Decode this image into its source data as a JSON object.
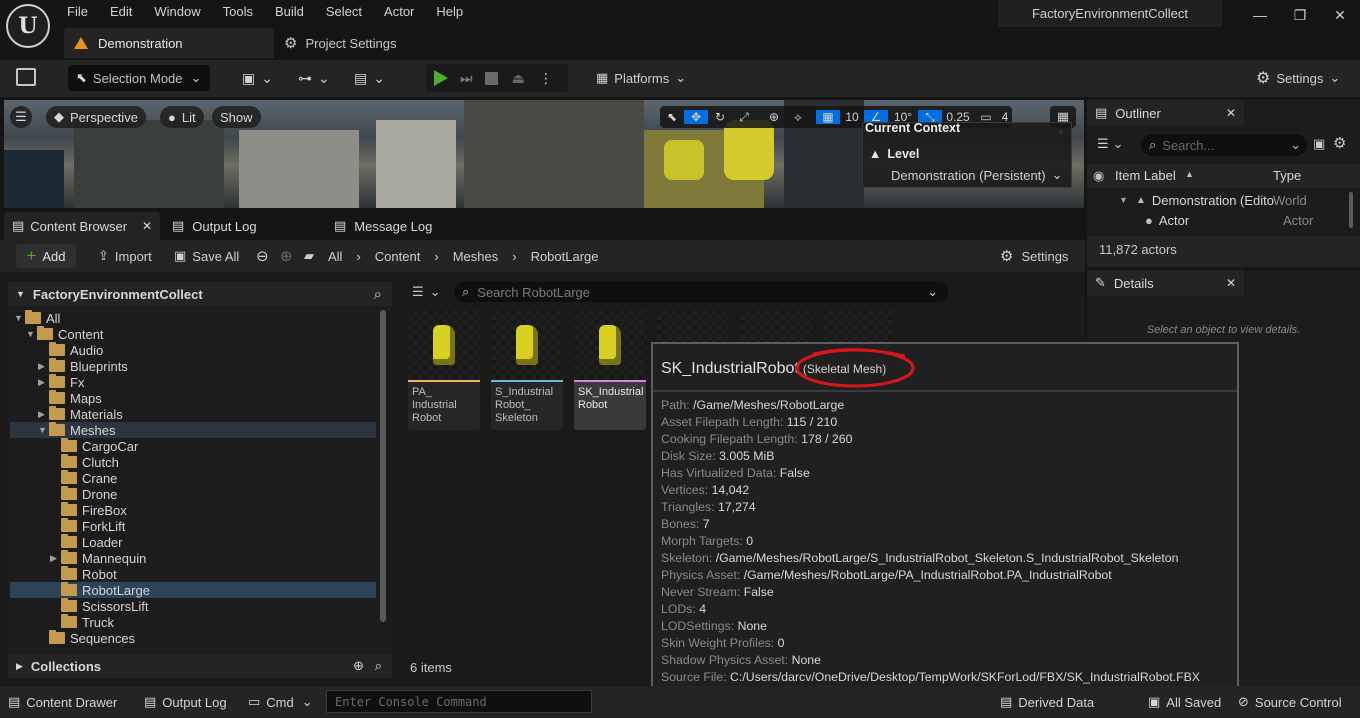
{
  "app": {
    "menu": [
      "File",
      "Edit",
      "Window",
      "Tools",
      "Build",
      "Select",
      "Actor",
      "Help"
    ],
    "document_tab": "Demonstration",
    "project_settings_tab": "Project Settings",
    "project_title": "FactoryEnvironmentCollect",
    "window_buttons": {
      "minimize": "—",
      "restore": "❐",
      "close": "✕"
    }
  },
  "toolbar": {
    "selection_mode": "Selection Mode",
    "platforms": "Platforms",
    "settings": "Settings"
  },
  "viewport": {
    "perspective": "Perspective",
    "lit": "Lit",
    "show": "Show",
    "grid_snap": "10",
    "rotation_snap": "10°",
    "scale_snap": "0.25",
    "camera_speed": "4",
    "current_context_label": "Current Context",
    "level_label": "Level",
    "level_value": "Demonstration (Persistent)"
  },
  "outliner": {
    "tab": "Outliner",
    "search_placeholder": "Search...",
    "col_label": "Item Label",
    "col_type": "Type",
    "rows": [
      {
        "label": "Demonstration (Edito",
        "type": "World"
      },
      {
        "label": "Actor",
        "type": "Actor"
      }
    ],
    "count": "11,872 actors"
  },
  "details": {
    "tab": "Details",
    "empty_text": "Select an object to view details."
  },
  "content_browser": {
    "tabs": [
      "Content Browser",
      "Output Log",
      "Message Log"
    ],
    "add": "Add",
    "import": "Import",
    "save_all": "Save All",
    "breadcrumb": [
      "All",
      "Content",
      "Meshes",
      "RobotLarge"
    ],
    "settings": "Settings",
    "tree_root": "FactoryEnvironmentCollect",
    "search_placeholder": "Search RobotLarge",
    "collections": "Collections",
    "item_count": "6 items",
    "tree": [
      {
        "label": "All",
        "depth": 0,
        "arrow": "▼"
      },
      {
        "label": "Content",
        "depth": 1,
        "arrow": "▼"
      },
      {
        "label": "Audio",
        "depth": 2,
        "arrow": ""
      },
      {
        "label": "Blueprints",
        "depth": 2,
        "arrow": "▶"
      },
      {
        "label": "Fx",
        "depth": 2,
        "arrow": "▶"
      },
      {
        "label": "Maps",
        "depth": 2,
        "arrow": ""
      },
      {
        "label": "Materials",
        "depth": 2,
        "arrow": "▶"
      },
      {
        "label": "Meshes",
        "depth": 2,
        "arrow": "▼"
      },
      {
        "label": "CargoCar",
        "depth": 3,
        "arrow": ""
      },
      {
        "label": "Clutch",
        "depth": 3,
        "arrow": ""
      },
      {
        "label": "Crane",
        "depth": 3,
        "arrow": ""
      },
      {
        "label": "Drone",
        "depth": 3,
        "arrow": ""
      },
      {
        "label": "FireBox",
        "depth": 3,
        "arrow": ""
      },
      {
        "label": "ForkLift",
        "depth": 3,
        "arrow": ""
      },
      {
        "label": "Loader",
        "depth": 3,
        "arrow": ""
      },
      {
        "label": "Mannequin",
        "depth": 3,
        "arrow": "▶"
      },
      {
        "label": "Robot",
        "depth": 3,
        "arrow": ""
      },
      {
        "label": "RobotLarge",
        "depth": 3,
        "arrow": ""
      },
      {
        "label": "ScissorsLift",
        "depth": 3,
        "arrow": ""
      },
      {
        "label": "Truck",
        "depth": 3,
        "arrow": ""
      },
      {
        "label": "Sequences",
        "depth": 2,
        "arrow": ""
      }
    ],
    "assets": [
      {
        "label": "PA_\nIndustrial\nRobot",
        "color": "#e8b86a"
      },
      {
        "label": "S_Industrial\nRobot_\nSkeleton",
        "color": "#6ab8d8"
      },
      {
        "label": "SK_Industrial\nRobot",
        "color": "#d08ad8"
      }
    ]
  },
  "tooltip": {
    "name": "SK_IndustrialRobot",
    "type": "(Skeletal Mesh)",
    "properties": [
      {
        "key": "Path:",
        "value": "/Game/Meshes/RobotLarge"
      },
      {
        "key": "Asset Filepath Length:",
        "value": "115 / 210"
      },
      {
        "key": "Cooking Filepath Length:",
        "value": "178 / 260"
      },
      {
        "key": "Disk Size:",
        "value": "3.005 MiB"
      },
      {
        "key": "Has Virtualized Data:",
        "value": "False"
      },
      {
        "key": "Vertices:",
        "value": "14,042"
      },
      {
        "key": "Triangles:",
        "value": "17,274"
      },
      {
        "key": "Bones:",
        "value": "7"
      },
      {
        "key": "Morph Targets:",
        "value": "0"
      },
      {
        "key": "Skeleton:",
        "value": "/Game/Meshes/RobotLarge/S_IndustrialRobot_Skeleton.S_IndustrialRobot_Skeleton"
      },
      {
        "key": "Physics Asset:",
        "value": "/Game/Meshes/RobotLarge/PA_IndustrialRobot.PA_IndustrialRobot"
      },
      {
        "key": "Never Stream:",
        "value": "False"
      },
      {
        "key": "LODs:",
        "value": "4"
      },
      {
        "key": "LODSettings:",
        "value": "None"
      },
      {
        "key": "Skin Weight Profiles:",
        "value": "0"
      },
      {
        "key": "Shadow Physics Asset:",
        "value": "None"
      },
      {
        "key": "Source File:",
        "value": "C:/Users/darcv/OneDrive/Desktop/TempWork/SKForLod/FBX/SK_IndustrialRobot.FBX"
      }
    ]
  },
  "statusbar": {
    "content_drawer": "Content Drawer",
    "output_log": "Output Log",
    "cmd": "Cmd",
    "console_placeholder": "Enter Console Command",
    "derived_data": "Derived Data",
    "all_saved": "All Saved",
    "source_control": "Source Control"
  },
  "colors": {
    "accent_play": "#4ab02a",
    "selection": "#2d4458",
    "folder": "#c69a4e",
    "annotation_circle": "#d8161b"
  }
}
